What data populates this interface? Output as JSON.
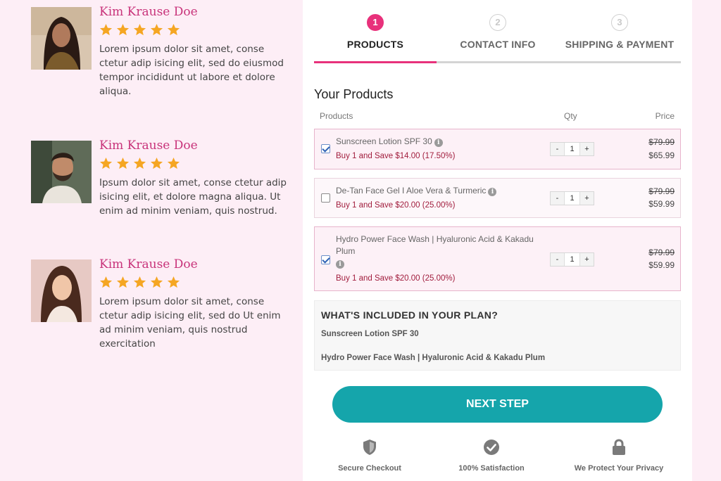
{
  "testimonials": [
    {
      "name": "Kim Krause Doe",
      "stars": 5,
      "text": "Lorem ipsum dolor sit amet, conse ctetur adip isicing elit, sed do eiusmod tempor incididunt ut labore et dolore aliqua."
    },
    {
      "name": "Kim Krause Doe",
      "stars": 5,
      "text": "Ipsum dolor sit amet, conse ctetur adip isicing elit, et dolore magna aliqua. Ut enim ad minim veniam, quis nostrud."
    },
    {
      "name": "Kim Krause Doe",
      "stars": 5,
      "text": "Lorem ipsum dolor sit amet, conse ctetur adip isicing elit, sed do Ut enim ad minim veniam, quis nostrud exercitation"
    }
  ],
  "steps": [
    {
      "number": "1",
      "label": "PRODUCTS"
    },
    {
      "number": "2",
      "label": "CONTACT INFO"
    },
    {
      "number": "3",
      "label": "SHIPPING & PAYMENT"
    }
  ],
  "products_section": {
    "title": "Your Products",
    "col_products": "Products",
    "col_qty": "Qty",
    "col_price": "Price"
  },
  "products": [
    {
      "name": "Sunscreen Lotion SPF 30",
      "checked": true,
      "save": "Buy 1 and Save $14.00 (17.50%)",
      "qty": "1",
      "old_price": "$79.99",
      "new_price": "$65.99"
    },
    {
      "name": "De-Tan Face Gel I Aloe Vera & Turmeric",
      "checked": false,
      "save": "Buy 1 and Save $20.00 (25.00%)",
      "qty": "1",
      "old_price": "$79.99",
      "new_price": "$59.99"
    },
    {
      "name_line1": "Hydro Power Face Wash | Hyaluronic Acid & Kakadu",
      "name_line2": "Plum",
      "checked": true,
      "save": "Buy 1 and Save $20.00 (25.00%)",
      "qty": "1",
      "old_price": "$79.99",
      "new_price": "$59.99"
    }
  ],
  "qty_controls": {
    "minus": "-",
    "plus": "+"
  },
  "included": {
    "heading": "WHAT'S INCLUDED IN YOUR PLAN?",
    "items": [
      "Sunscreen Lotion SPF 30",
      "Hydro Power Face Wash | Hyaluronic Acid & Kakadu Plum"
    ]
  },
  "next_button": "NEXT STEP",
  "trust_badges": [
    {
      "icon": "shield-icon",
      "label": "Secure Checkout"
    },
    {
      "icon": "check-circle-icon",
      "label": "100% Satisfaction"
    },
    {
      "icon": "lock-icon",
      "label": "We Protect Your Privacy"
    }
  ],
  "colors": {
    "page_bg": "#fdeef6",
    "accent_pink": "#e8317b",
    "name_pink": "#c8337a",
    "star": "#f5a623",
    "button_teal": "#15a5ab",
    "save_red": "#a11d3d"
  }
}
